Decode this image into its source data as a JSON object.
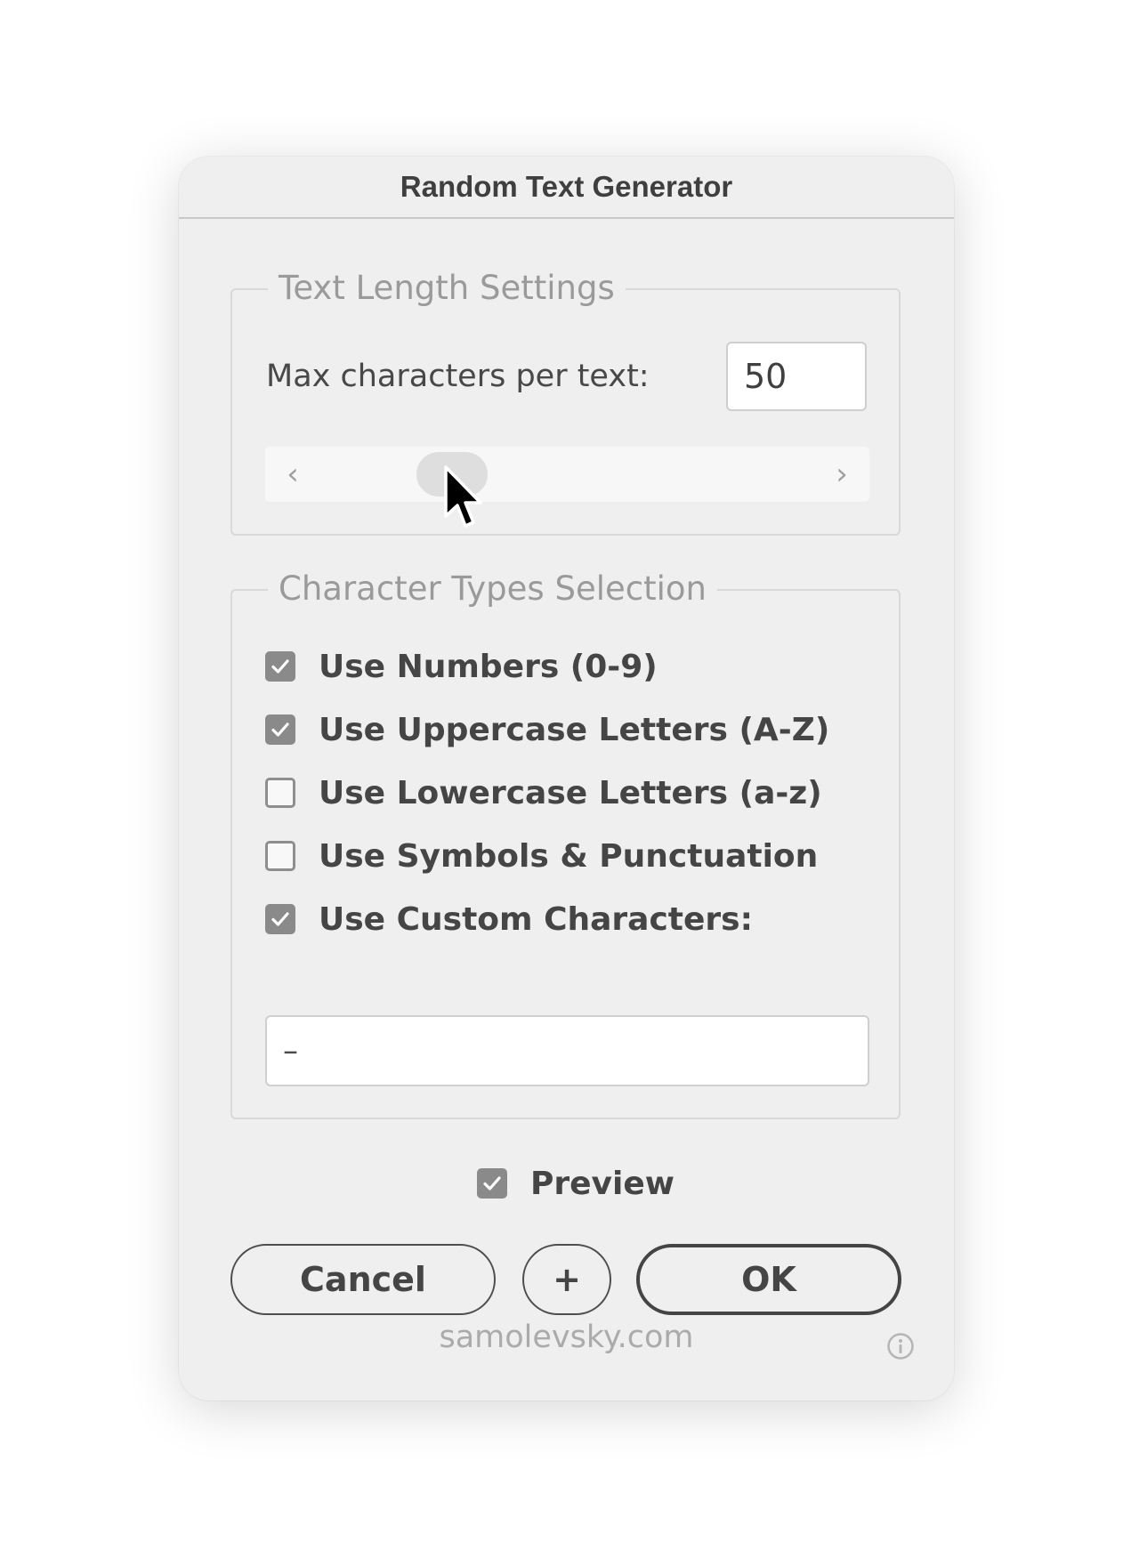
{
  "dialog": {
    "title": "Random Text Generator",
    "text_length": {
      "legend": "Text Length Settings",
      "max_label": "Max characters per text:",
      "max_value": "50",
      "slider_left_arrow": "‹",
      "slider_right_arrow": "›"
    },
    "character_types": {
      "legend": "Character Types Selection",
      "options": [
        {
          "label": "Use Numbers (0-9)",
          "checked": true
        },
        {
          "label": "Use Uppercase Letters (A-Z)",
          "checked": true
        },
        {
          "label": "Use Lowercase Letters (a-z)",
          "checked": false
        },
        {
          "label": "Use Symbols & Punctuation",
          "checked": false
        },
        {
          "label": "Use Custom Characters:",
          "checked": true
        }
      ],
      "custom_value": "–"
    },
    "preview": {
      "label": "Preview",
      "checked": true
    },
    "buttons": {
      "cancel": "Cancel",
      "add": "+",
      "ok": "OK"
    },
    "footer": "samolevsky.com"
  },
  "icons": {
    "checkmark": "checkmark-icon",
    "info": "info-icon",
    "cursor": "mouse-pointer-icon"
  },
  "colors": {
    "dialog_bg": "#efefef",
    "checkbox_on": "#8a8a8a",
    "text": "#454545",
    "muted": "#9a9a9a"
  }
}
